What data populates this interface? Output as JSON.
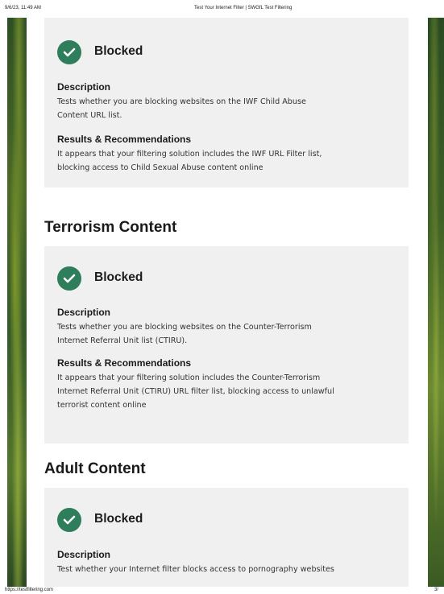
{
  "print_header": {
    "datetime": "9/6/23, 11:49 AM",
    "page_title": "Test Your Internet Filter | SWGfL Test Filtering"
  },
  "print_footer": {
    "url": "https://testfiltering.com",
    "page_number": "3/"
  },
  "colors": {
    "check_badge": "#2e7d5b",
    "card_background": "#f0f0f0"
  },
  "sections": [
    {
      "heading": "",
      "status": "Blocked",
      "status_icon": "check-circle-icon",
      "description_label": "Description",
      "description_lines": [
        "Tests whether you are blocking websites on the IWF Child Abuse",
        "Content URL list."
      ],
      "results_label": "Results & Recommendations",
      "results_lines": [
        "It appears that your filtering solution includes the IWF URL Filter list,",
        "blocking access to Child Sexual Abuse content online"
      ]
    },
    {
      "heading": "Terrorism Content",
      "status": "Blocked",
      "status_icon": "check-circle-icon",
      "description_label": "Description",
      "description_lines": [
        "Tests whether you are blocking websites on the Counter-Terrorism",
        "Internet Referral Unit list (CTIRU)."
      ],
      "results_label": "Results & Recommendations",
      "results_lines": [
        "It appears that your filtering solution includes the Counter-Terrorism",
        "Internet Referral Unit (CTIRU) URL filter list, blocking access to unlawful",
        "terrorist content online"
      ]
    },
    {
      "heading": "Adult Content",
      "status": "Blocked",
      "status_icon": "check-circle-icon",
      "description_label": "Description",
      "description_lines": [
        "Test whether your Internet filter blocks access to pornography websites"
      ]
    }
  ]
}
